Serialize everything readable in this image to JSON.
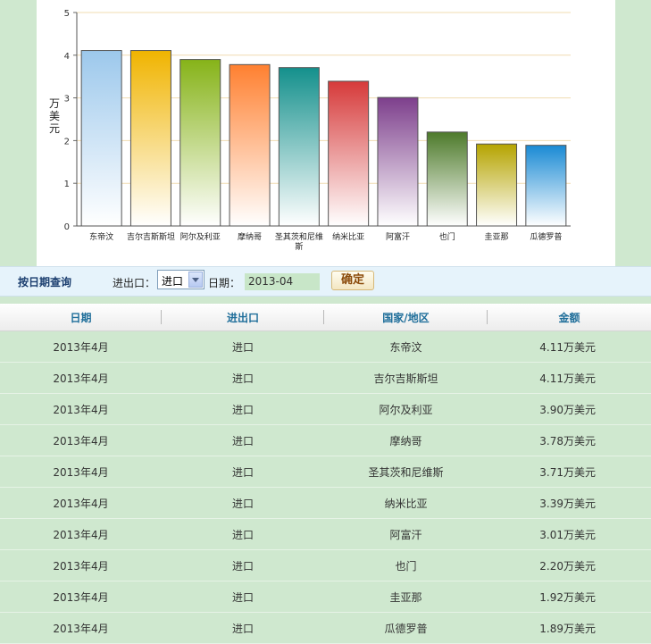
{
  "chart_data": {
    "type": "bar",
    "title": "",
    "xlabel": "",
    "ylabel": "万美元",
    "ylim": [
      0,
      5
    ],
    "yticks": [
      0,
      1,
      2,
      3,
      4,
      5
    ],
    "grid": true,
    "categories": [
      "东帝汶",
      "吉尔吉斯斯坦",
      "阿尔及利亚",
      "摩纳哥",
      "圣其茨和尼维斯",
      "纳米比亚",
      "阿富汗",
      "也门",
      "圭亚那",
      "瓜德罗普"
    ],
    "values": [
      4.11,
      4.11,
      3.9,
      3.78,
      3.71,
      3.39,
      3.01,
      2.2,
      1.92,
      1.89
    ],
    "colors": [
      "#9cc8ec",
      "#f0b400",
      "#86b318",
      "#ff8030",
      "#14908c",
      "#d63a3a",
      "#7d3f8c",
      "#4d7a2a",
      "#b5a400",
      "#1a8ad4"
    ]
  },
  "query": {
    "title": "按日期查询",
    "direction_label": "进出口：",
    "direction_value": "进口",
    "date_label": "日期：",
    "date_value": "2013-04",
    "confirm_label": "确定"
  },
  "table": {
    "headers": [
      "日期",
      "进出口",
      "国家/地区",
      "金额"
    ],
    "rows": [
      [
        "2013年4月",
        "进口",
        "东帝汶",
        "4.11万美元"
      ],
      [
        "2013年4月",
        "进口",
        "吉尔吉斯斯坦",
        "4.11万美元"
      ],
      [
        "2013年4月",
        "进口",
        "阿尔及利亚",
        "3.90万美元"
      ],
      [
        "2013年4月",
        "进口",
        "摩纳哥",
        "3.78万美元"
      ],
      [
        "2013年4月",
        "进口",
        "圣其茨和尼维斯",
        "3.71万美元"
      ],
      [
        "2013年4月",
        "进口",
        "纳米比亚",
        "3.39万美元"
      ],
      [
        "2013年4月",
        "进口",
        "阿富汗",
        "3.01万美元"
      ],
      [
        "2013年4月",
        "进口",
        "也门",
        "2.20万美元"
      ],
      [
        "2013年4月",
        "进口",
        "圭亚那",
        "1.92万美元"
      ],
      [
        "2013年4月",
        "进口",
        "瓜德罗普",
        "1.89万美元"
      ]
    ]
  }
}
